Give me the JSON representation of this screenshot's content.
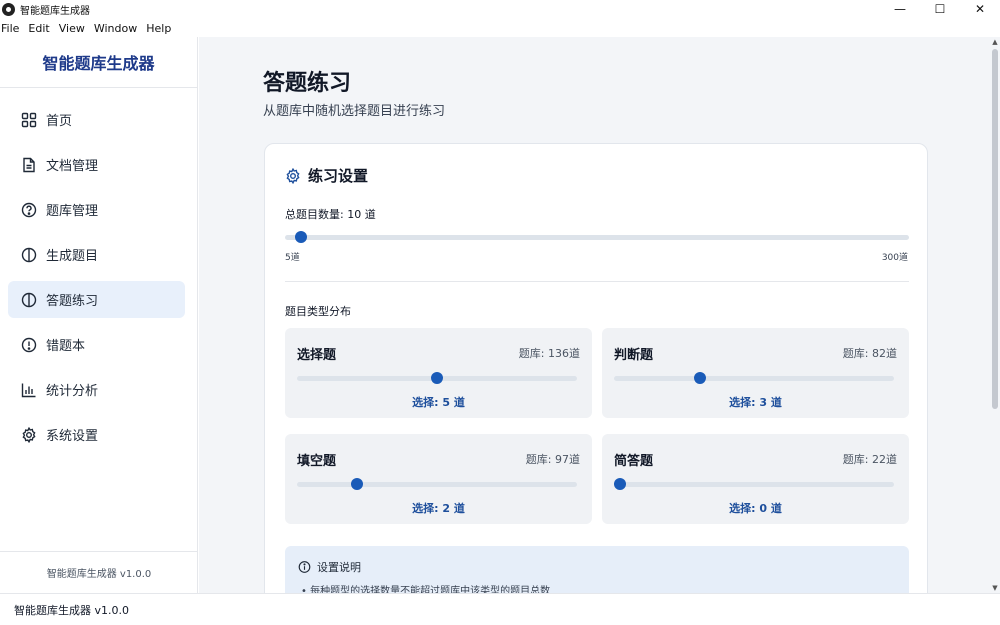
{
  "window": {
    "title": "智能题库生成器",
    "minimize_glyph": "—",
    "maximize_glyph": "☐",
    "close_glyph": "✕"
  },
  "menu": [
    "File",
    "Edit",
    "View",
    "Window",
    "Help"
  ],
  "sidebar": {
    "brand": "智能题库生成器",
    "items": [
      {
        "label": "首页",
        "icon": "grid-icon"
      },
      {
        "label": "文档管理",
        "icon": "document-icon"
      },
      {
        "label": "题库管理",
        "icon": "question-icon"
      },
      {
        "label": "生成题目",
        "icon": "leaf-icon"
      },
      {
        "label": "答题练习",
        "icon": "leaf-icon",
        "active": true
      },
      {
        "label": "错题本",
        "icon": "alert-icon"
      },
      {
        "label": "统计分析",
        "icon": "bar-chart-icon"
      },
      {
        "label": "系统设置",
        "icon": "gear-icon"
      }
    ],
    "footer": "智能题库生成器 v1.0.0"
  },
  "main": {
    "title": "答题练习",
    "subtitle": "从题库中随机选择题目进行练习",
    "settings": {
      "header": "练习设置",
      "total_label": "总题目数量: 10 道",
      "total": {
        "value": 10,
        "min": 5,
        "max": 300
      },
      "min_label": "5道",
      "max_label": "300道",
      "distribution_label": "题目类型分布",
      "types": [
        {
          "name": "选择题",
          "bank": "题库: 136道",
          "select": "选择: 5 道",
          "value": 5,
          "max": 10
        },
        {
          "name": "判断题",
          "bank": "题库: 82道",
          "select": "选择: 3 道",
          "value": 3,
          "max": 10
        },
        {
          "name": "填空题",
          "bank": "题库: 97道",
          "select": "选择: 2 道",
          "value": 2,
          "max": 10
        },
        {
          "name": "简答题",
          "bank": "题库: 22道",
          "select": "选择: 0 道",
          "value": 0,
          "max": 10
        }
      ],
      "note": {
        "title": "设置说明",
        "items": [
          "• 每种题型的选择数量不能超过题库中该类型的题目总数"
        ]
      }
    }
  },
  "statusbar": {
    "text": "智能题库生成器 v1.0.0"
  },
  "colors": {
    "accent": "#1a5bb8",
    "active_bg": "#e8f0fb",
    "brand": "#1e3a8a"
  }
}
